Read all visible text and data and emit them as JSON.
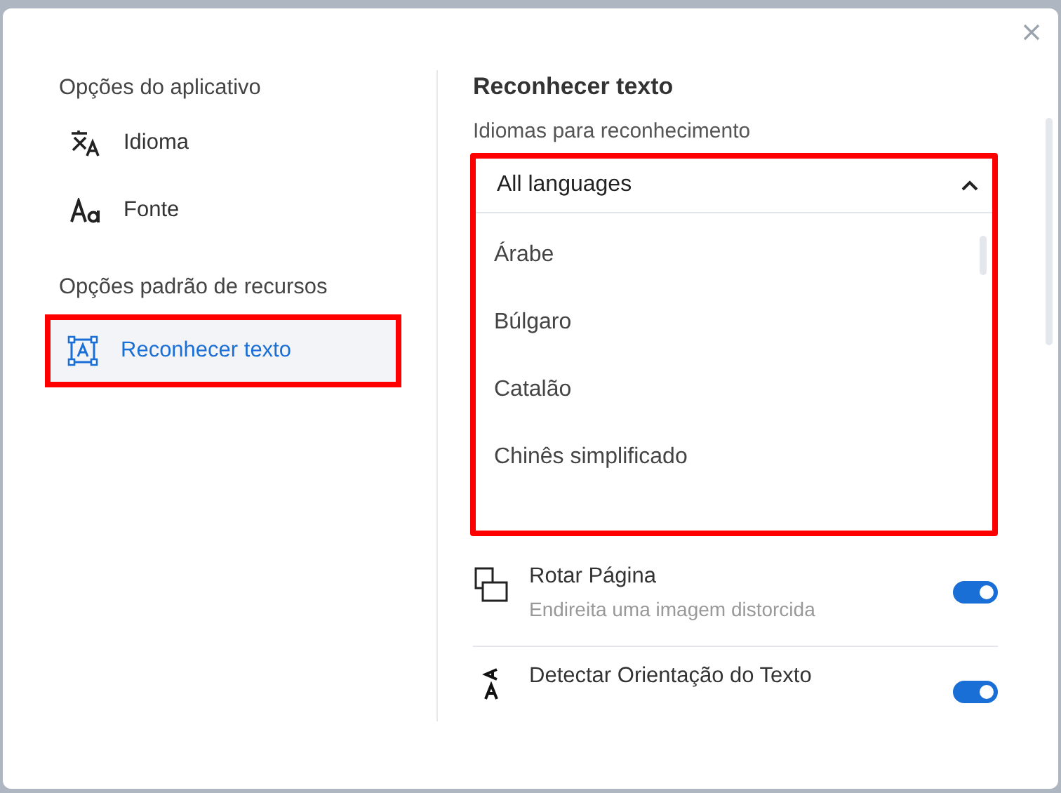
{
  "sidebar": {
    "sections": [
      {
        "title": "Opções do aplicativo",
        "items": [
          {
            "kind": "translate",
            "label": "Idioma",
            "selected": false,
            "highlighted": false
          },
          {
            "kind": "font",
            "label": "Fonte",
            "selected": false,
            "highlighted": false
          }
        ]
      },
      {
        "title": "Opções padrão de recursos",
        "items": [
          {
            "kind": "ocr",
            "label": "Reconhecer texto",
            "selected": true,
            "highlighted": true
          }
        ]
      }
    ]
  },
  "panel": {
    "title": "Reconhecer texto",
    "language_label": "Idiomas para reconhecimento",
    "dropdown": {
      "value": "All languages",
      "expanded": true,
      "highlighted": true,
      "options": [
        "Árabe",
        "Búlgaro",
        "Catalão",
        "Chinês simplificado"
      ]
    },
    "settings": [
      {
        "kind": "rotate",
        "title": "Rotar Página",
        "description": "Endireita uma imagem distorcida",
        "on": true
      },
      {
        "kind": "orientation",
        "title": "Detectar Orientação do Texto",
        "on": true
      }
    ]
  }
}
